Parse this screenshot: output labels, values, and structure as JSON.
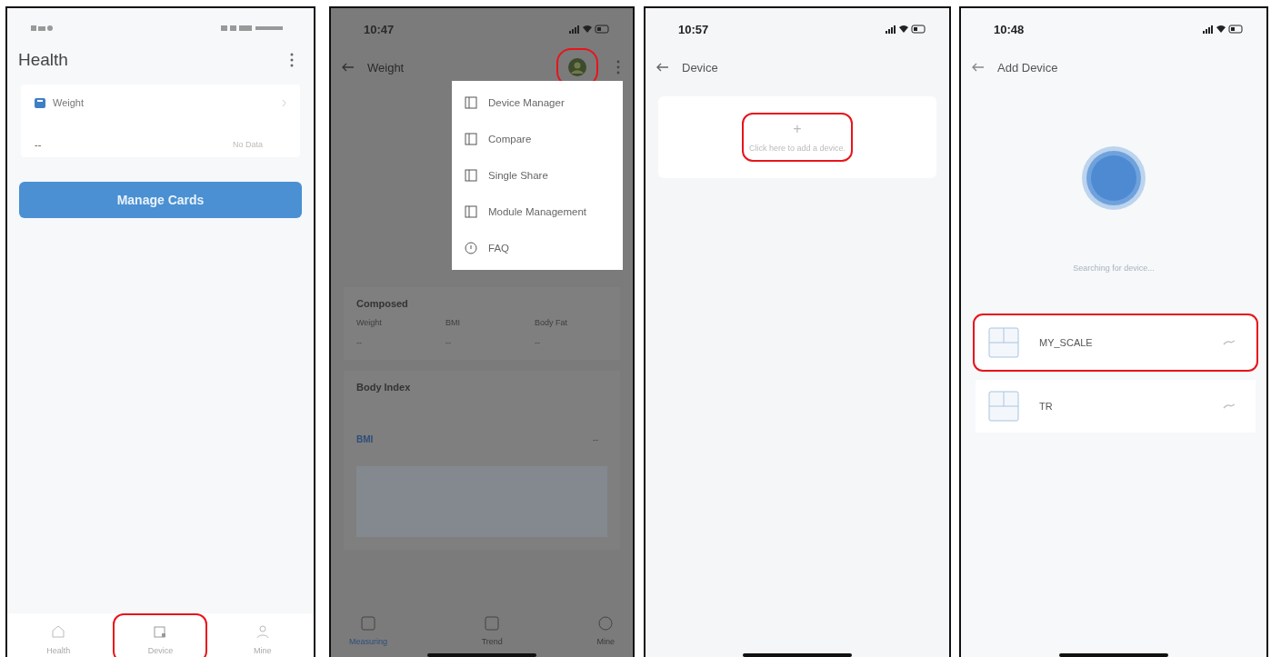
{
  "health_screen": {
    "title": "Health",
    "card": {
      "title": "Weight",
      "value": "--",
      "status": "No Data"
    },
    "button": "Manage Cards",
    "tabs": [
      {
        "label": "Health",
        "highlighted": false
      },
      {
        "label": "Device",
        "highlighted": true
      },
      {
        "label": "Mine",
        "highlighted": false
      }
    ]
  },
  "weight_screen": {
    "time": "10:47",
    "title": "Weight",
    "avatar_highlighted": true,
    "menu": [
      {
        "label": "Device Manager"
      },
      {
        "label": "Compare"
      },
      {
        "label": "Single Share"
      },
      {
        "label": "Module Management"
      },
      {
        "label": "FAQ"
      }
    ],
    "composed": {
      "title": "Composed",
      "metrics": [
        {
          "label": "Weight",
          "value": "--"
        },
        {
          "label": "BMI",
          "value": "--"
        },
        {
          "label": "Body Fat",
          "value": "--"
        }
      ]
    },
    "body_index": {
      "title": "Body Index",
      "badge": "BMI",
      "value": "--"
    },
    "tabs": [
      {
        "label": "Measuring",
        "selected": true
      },
      {
        "label": "Trend",
        "selected": false
      },
      {
        "label": "Mine",
        "selected": false
      }
    ]
  },
  "device_screen": {
    "time": "10:57",
    "title": "Device",
    "add_card": {
      "icon": "+",
      "text": "Click here to add a device.",
      "highlighted": true
    }
  },
  "add_device_screen": {
    "time": "10:48",
    "title": "Add Device",
    "status": "Searching for device...",
    "devices": [
      {
        "name": "MY_SCALE",
        "highlighted": true
      },
      {
        "name": "TR",
        "highlighted": false
      }
    ]
  }
}
